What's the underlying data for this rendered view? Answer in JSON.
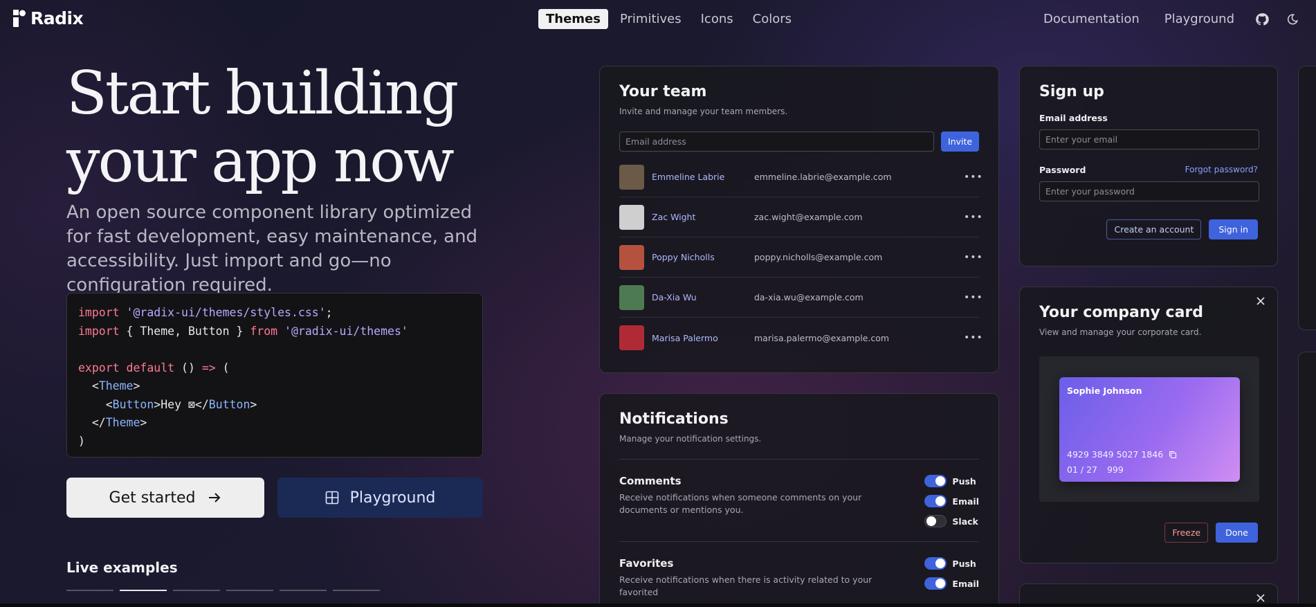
{
  "nav": {
    "brand": "Radix",
    "center": [
      {
        "label": "Themes",
        "active": true
      },
      {
        "label": "Primitives",
        "active": false
      },
      {
        "label": "Icons",
        "active": false
      },
      {
        "label": "Colors",
        "active": false
      }
    ],
    "right": [
      "Documentation",
      "Playground"
    ]
  },
  "hero": {
    "title_line1": "Start building",
    "title_line2": "your app now",
    "subtitle": "An open source component library optimized for fast development, easy maintenance, and accessibility. Just import and go—no configuration required.",
    "code": {
      "l1_kw": "import",
      "l1_str": "'@radix-ui/themes/styles.css'",
      "l1_end": ";",
      "l2_kw": "import",
      "l2_mid": " { Theme, Button } ",
      "l2_from": "from",
      "l2_str": "'@radix-ui/themes'",
      "l3_kw1": "export",
      "l3_kw2": "default",
      "l3_mid": " () ",
      "l3_arrow": "=>",
      "l3_end": " (",
      "l4_tag": "Theme",
      "l5_tag": "Button",
      "l5_text": "Hey ",
      "l5_glyph": "⊠",
      "l6_tag": "Theme",
      "l7": ")"
    },
    "get_started": "Get started",
    "playground": "Playground",
    "live_label": "Live examples",
    "live_tabs": [
      false,
      true,
      false,
      false,
      false,
      false
    ]
  },
  "team": {
    "title": "Your team",
    "desc": "Invite and manage your team members.",
    "email_placeholder": "Email address",
    "invite": "Invite",
    "members": [
      {
        "name": "Emmeline Labrie",
        "email": "emmeline.labrie@example.com",
        "color": "#6b5a48"
      },
      {
        "name": "Zac Wight",
        "email": "zac.wight@example.com",
        "color": "#cfcfcf"
      },
      {
        "name": "Poppy Nicholls",
        "email": "poppy.nicholls@example.com",
        "color": "#b5523e"
      },
      {
        "name": "Da-Xia Wu",
        "email": "da-xia.wu@example.com",
        "color": "#4d7a52"
      },
      {
        "name": "Marisa Palermo",
        "email": "marisa.palermo@example.com",
        "color": "#b02a36"
      }
    ]
  },
  "notifications": {
    "title": "Notifications",
    "desc": "Manage your notification settings.",
    "groups": [
      {
        "title": "Comments",
        "text": "Receive notifications when someone comments on your documents or mentions you.",
        "toggles": [
          {
            "label": "Push",
            "on": true
          },
          {
            "label": "Email",
            "on": true
          },
          {
            "label": "Slack",
            "on": false
          }
        ]
      },
      {
        "title": "Favorites",
        "text": "Receive notifications when there is activity related to your favorited",
        "toggles": [
          {
            "label": "Push",
            "on": true
          },
          {
            "label": "Email",
            "on": true
          }
        ]
      }
    ]
  },
  "signup": {
    "title": "Sign up",
    "email_label": "Email address",
    "email_placeholder": "Enter your email",
    "password_label": "Password",
    "forgot": "Forgot password?",
    "password_placeholder": "Enter your password",
    "create": "Create an account",
    "signin": "Sign in"
  },
  "company": {
    "title": "Your company card",
    "desc": "View and manage your corporate card.",
    "holder": "Sophie Johnson",
    "number": "4929 3849 5027 1846",
    "expiry": "01 / 27",
    "cvc": "999",
    "freeze": "Freeze",
    "done": "Done"
  }
}
